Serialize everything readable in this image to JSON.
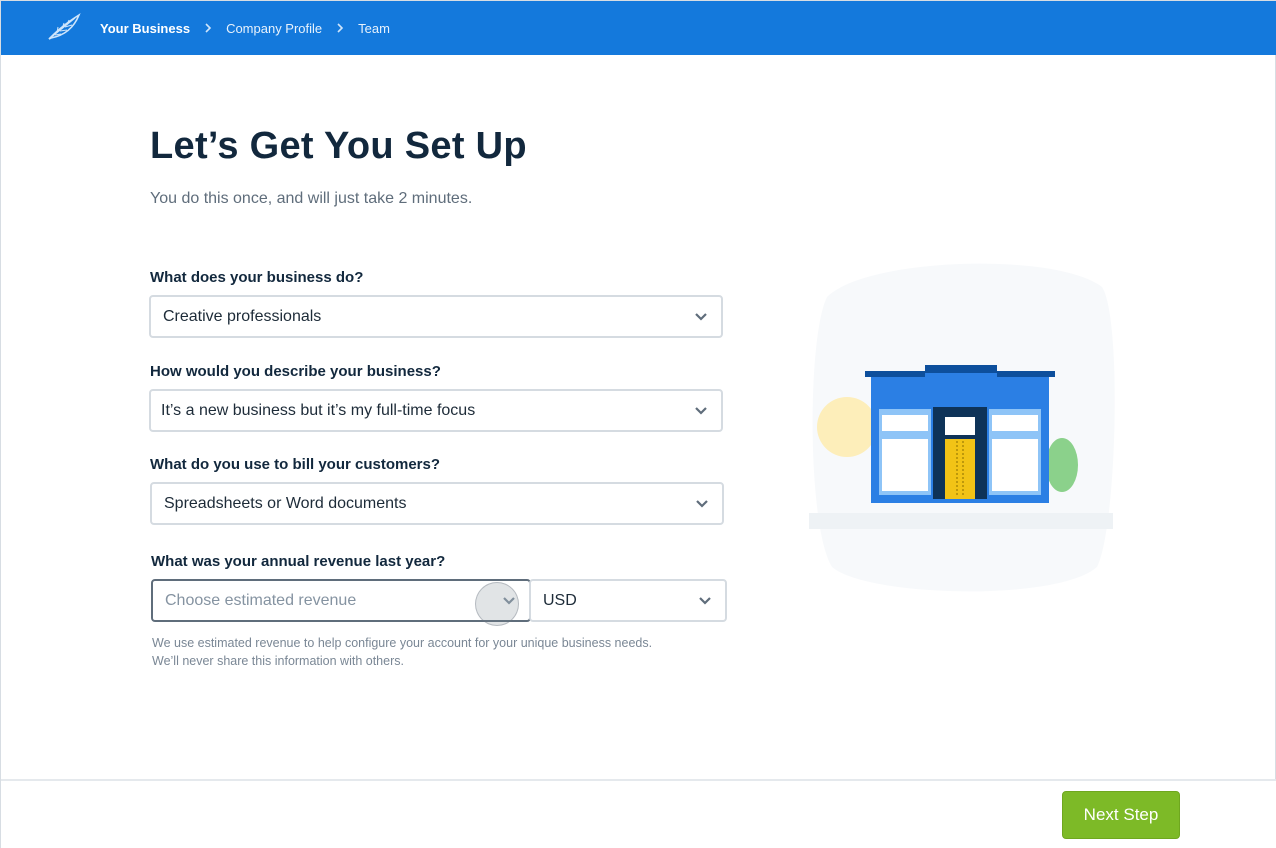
{
  "header": {
    "logo_icon": "leaf-logo-icon",
    "breadcrumbs": [
      "Your Business",
      "Company Profile",
      "Team"
    ],
    "background": "#1479dc"
  },
  "main": {
    "title": "Let’s Get You Set Up",
    "subtitle": "You do this once, and will just take 2 minutes.",
    "fields": [
      {
        "label": "What does your business do?",
        "value": "Creative professionals"
      },
      {
        "label": "How would you describe your business?",
        "value": "It’s a new business but it’s my full-time focus"
      },
      {
        "label": "What do you use to bill your customers?",
        "value": "Spreadsheets or Word documents"
      },
      {
        "label": "What was your annual revenue last year?",
        "placeholder": "Choose estimated revenue",
        "currency": "USD"
      }
    ],
    "helper_lines": [
      "We use estimated revenue to help configure your account for your unique business needs.",
      "We’ll never share this information with others."
    ],
    "illustration_icon": "storefront-illustration"
  },
  "footer": {
    "next_label": "Next Step",
    "next_color": "#7dba27"
  }
}
